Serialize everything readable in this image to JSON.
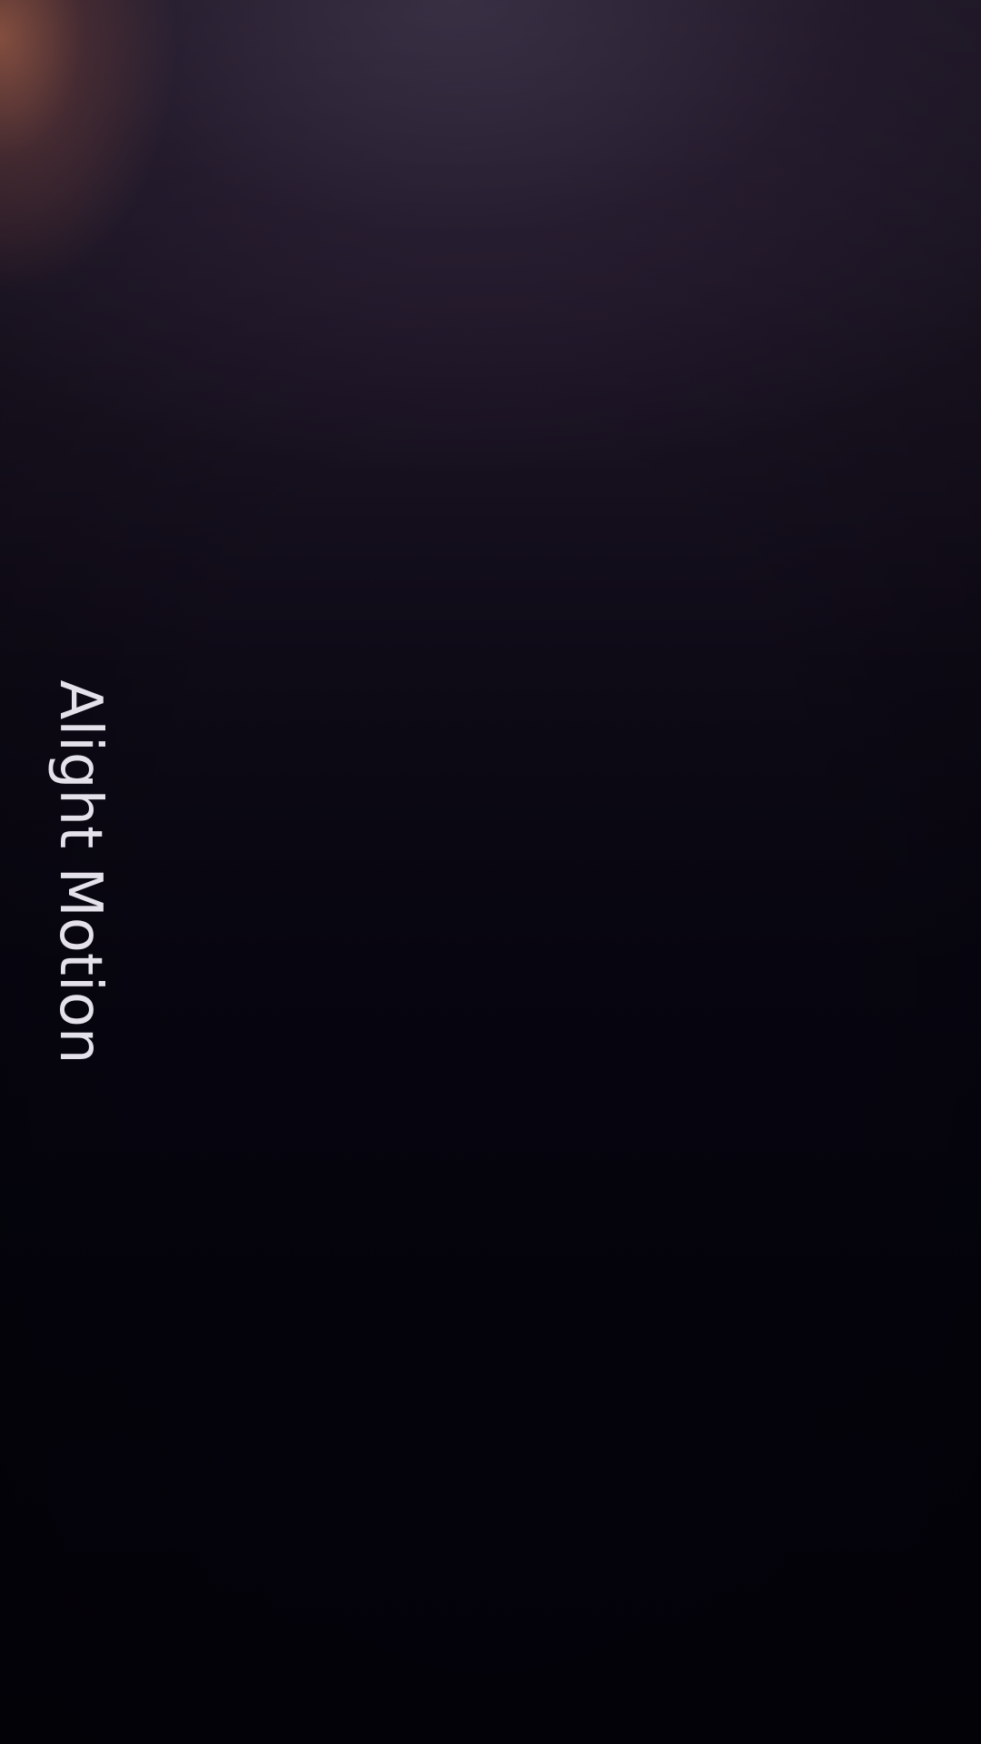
{
  "splash": {
    "brand_text": "Alight Motion"
  },
  "colors": {
    "background_top": "#2e2438",
    "background_bottom": "#030209",
    "glow": "#d67e60",
    "text": "#e4e1ea"
  }
}
